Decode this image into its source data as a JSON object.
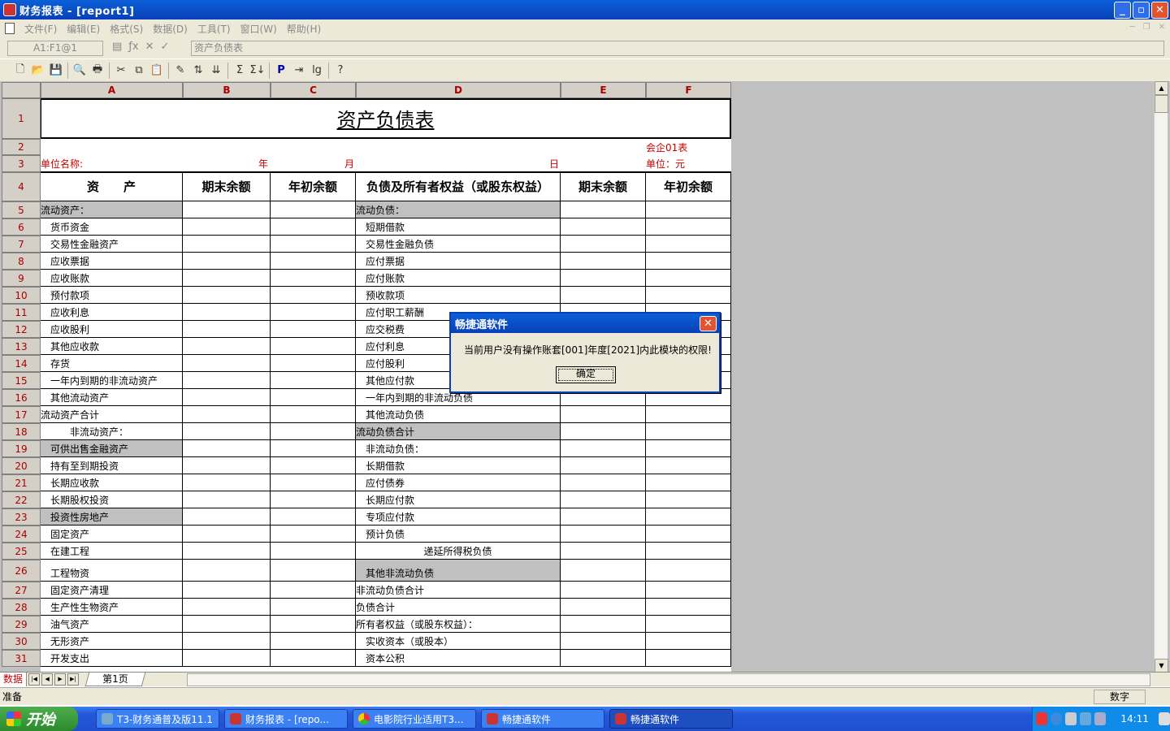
{
  "window": {
    "title": "财务报表 - [report1]",
    "minimize": "_",
    "restore": "▫",
    "close": "✕"
  },
  "menu": [
    "文件(F)",
    "编辑(E)",
    "格式(S)",
    "数据(D)",
    "工具(T)",
    "窗口(W)",
    "帮助(H)"
  ],
  "formula_bar": {
    "cell_ref": "A1:F1@1",
    "content": "资产负债表"
  },
  "columns": [
    "A",
    "B",
    "C",
    "D",
    "E",
    "F"
  ],
  "sheet": {
    "title": "资产负债表",
    "form_no": "会企01表",
    "unit_name_label": "单位名称:",
    "year_label": "年",
    "month_label": "月",
    "day_label": "日",
    "unit_label": "单位：元",
    "headers": [
      "资　　产",
      "期末余额",
      "年初余额",
      "负债及所有者权益（或股东权益）",
      "期末余额",
      "年初余额"
    ],
    "rows": [
      {
        "n": "5",
        "a": "流动资产：",
        "d": "流动负债："
      },
      {
        "n": "6",
        "a": "　货币资金",
        "d": "　短期借款"
      },
      {
        "n": "7",
        "a": "　交易性金融资产",
        "d": "　交易性金融负债"
      },
      {
        "n": "8",
        "a": "　应收票据",
        "d": "　应付票据"
      },
      {
        "n": "9",
        "a": "　应收账款",
        "d": "　应付账款"
      },
      {
        "n": "10",
        "a": "　预付款项",
        "d": "　预收款项"
      },
      {
        "n": "11",
        "a": "　应收利息",
        "d": "　应付职工薪酬"
      },
      {
        "n": "12",
        "a": "　应收股利",
        "d": "　应交税费"
      },
      {
        "n": "13",
        "a": "　其他应收款",
        "d": "　应付利息"
      },
      {
        "n": "14",
        "a": "　存货",
        "d": "　应付股利"
      },
      {
        "n": "15",
        "a": "　一年内到期的非流动资产",
        "d": "　其他应付款"
      },
      {
        "n": "16",
        "a": "　其他流动资产",
        "d": "　一年内到期的非流动负债"
      },
      {
        "n": "17",
        "a": "流动资产合计",
        "d": "　其他流动负债"
      },
      {
        "n": "18",
        "a": "　　　非流动资产：",
        "d": "流动负债合计"
      },
      {
        "n": "19",
        "a": "　可供出售金融资产",
        "d": "　非流动负债："
      },
      {
        "n": "20",
        "a": "　持有至到期投资",
        "d": "　长期借款"
      },
      {
        "n": "21",
        "a": "　长期应收款",
        "d": "　应付债券"
      },
      {
        "n": "22",
        "a": "　长期股权投资",
        "d": "　长期应付款"
      },
      {
        "n": "23",
        "a": "　投资性房地产",
        "d": "　专项应付款"
      },
      {
        "n": "24",
        "a": "　固定资产",
        "d": "　预计负债"
      },
      {
        "n": "25",
        "a": "　在建工程",
        "d": "递延所得税负债"
      },
      {
        "n": "26",
        "a": "　工程物资",
        "d": "　其他非流动负债"
      },
      {
        "n": "27",
        "a": "　固定资产清理",
        "d": "非流动负债合计"
      },
      {
        "n": "28",
        "a": "　生产性生物资产",
        "d": "负债合计"
      },
      {
        "n": "29",
        "a": "　油气资产",
        "d": "所有者权益（或股东权益）："
      },
      {
        "n": "30",
        "a": "　无形资产",
        "d": "　实收资本（或股本）"
      },
      {
        "n": "31",
        "a": "　开发支出",
        "d": "　资本公积"
      }
    ]
  },
  "sheet_tabs": {
    "mode": "数据",
    "page": "第1页"
  },
  "status": {
    "left": "准备",
    "mode": "数字"
  },
  "dialog": {
    "title": "畅捷通软件",
    "message": "当前用户没有操作账套[001]年度[2021]内此模块的权限!",
    "ok": "确定"
  },
  "taskbar": {
    "start": "开始",
    "items": [
      "T3-财务通普及版11.1",
      "财务报表 - [repo...",
      "电影院行业适用T3...",
      "畅捷通软件",
      "畅捷通软件"
    ],
    "clock": "14:11"
  }
}
